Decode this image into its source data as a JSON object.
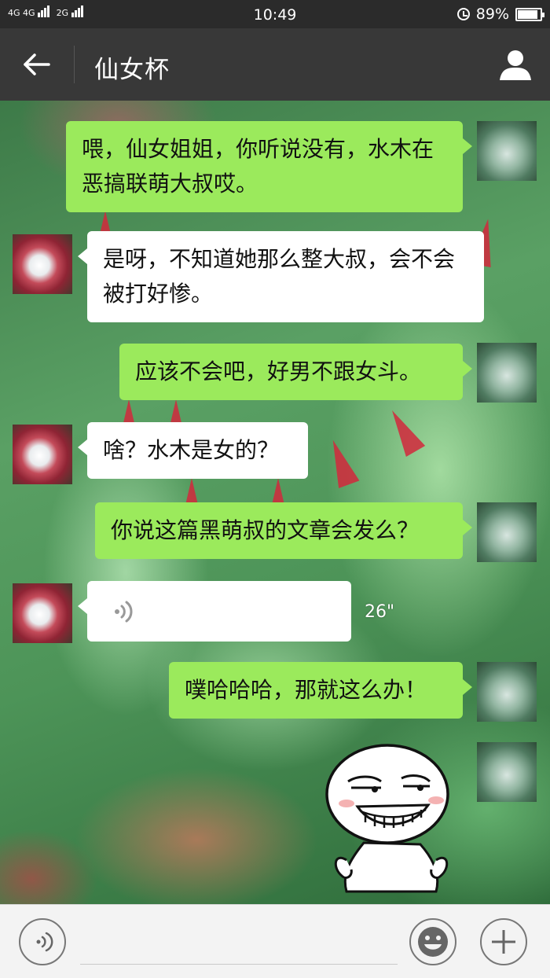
{
  "status_bar": {
    "network_1": "4G",
    "network_2": "4G",
    "network_3": "2G",
    "time": "10:49",
    "battery_percent": "89%",
    "battery_level": 0.89,
    "icons": [
      "signal-icon",
      "alarm-icon",
      "battery-icon"
    ]
  },
  "header": {
    "title": "仙女杯",
    "icons": [
      "back-arrow-icon",
      "person-icon"
    ]
  },
  "messages": [
    {
      "side": "sent",
      "text": "喂，仙女姐姐，你听说没有，水木在恶搞联萌大叔哎。"
    },
    {
      "side": "received",
      "text": "是呀，不知道她那么整大叔，会不会被打好惨。"
    },
    {
      "side": "sent",
      "text": "应该不会吧，好男不跟女斗。"
    },
    {
      "side": "received",
      "text": "啥？水木是女的？"
    },
    {
      "side": "sent",
      "text": "你说这篇黑萌叔的文章会发么？"
    },
    {
      "side": "received",
      "type": "voice",
      "duration": "26\""
    },
    {
      "side": "sent",
      "text": "噗哈哈哈，那就这么办！"
    },
    {
      "side": "sent",
      "type": "sticker",
      "sticker": "smirking-face-sticker"
    }
  ],
  "input_bar": {
    "input_value": "",
    "icons": [
      "voice-icon",
      "emoji-icon",
      "plus-icon"
    ]
  },
  "colors": {
    "sent_bubble": "#9bea5c",
    "received_bubble": "#ffffff",
    "title_bar": "#383838",
    "status_bar": "#2b2b2b"
  }
}
